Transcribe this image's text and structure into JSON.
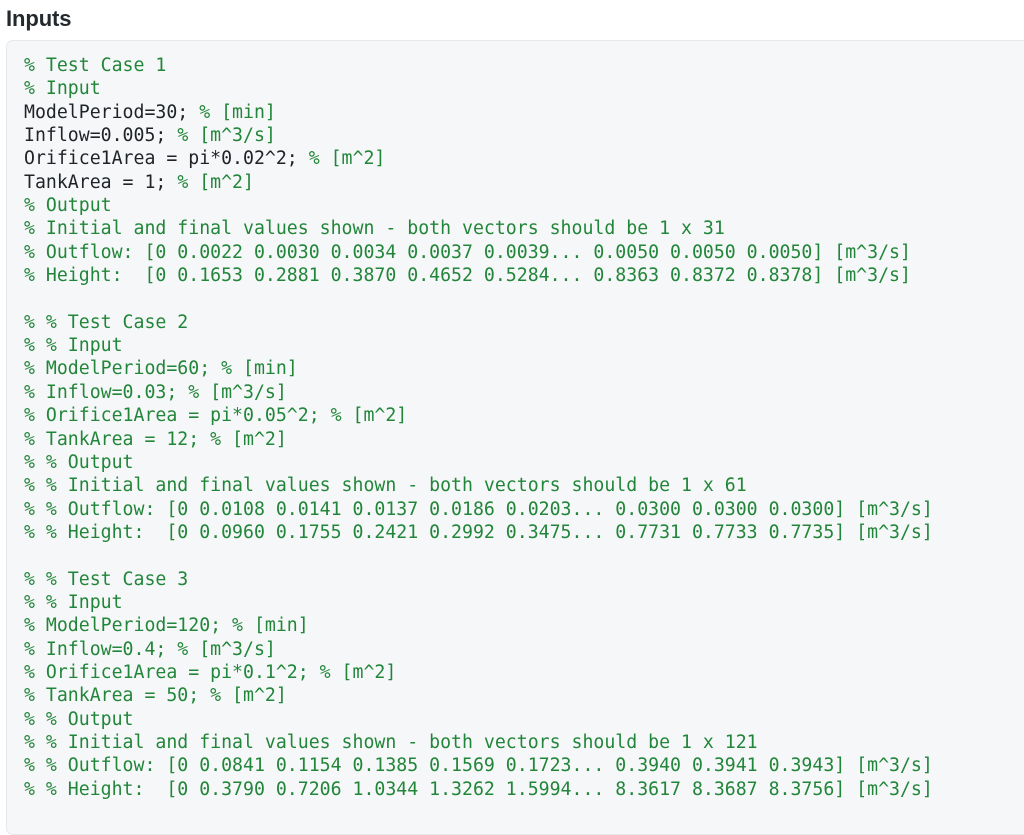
{
  "header": {
    "title": "Inputs"
  },
  "code_block": {
    "language": "matlab",
    "comment_color": "#22863a",
    "code_color": "#1f2328",
    "background_color": "#f6f7f8",
    "border_color": "#e6e8ea",
    "lines": [
      {
        "type": "comment",
        "text": "% Test Case 1"
      },
      {
        "type": "comment",
        "text": "% Input"
      },
      {
        "type": "mixed",
        "code": "ModelPeriod=30; ",
        "comment": "% [min]"
      },
      {
        "type": "mixed",
        "code": "Inflow=0.005; ",
        "comment": "% [m^3/s]"
      },
      {
        "type": "mixed",
        "code": "Orifice1Area = pi*0.02^2; ",
        "comment": "% [m^2]"
      },
      {
        "type": "mixed",
        "code": "TankArea = 1; ",
        "comment": "% [m^2]"
      },
      {
        "type": "comment",
        "text": "% Output"
      },
      {
        "type": "comment",
        "text": "% Initial and final values shown - both vectors should be 1 x 31"
      },
      {
        "type": "comment",
        "text": "% Outflow: [0 0.0022 0.0030 0.0034 0.0037 0.0039... 0.0050 0.0050 0.0050] [m^3/s]"
      },
      {
        "type": "comment",
        "text": "% Height:  [0 0.1653 0.2881 0.3870 0.4652 0.5284... 0.8363 0.8372 0.8378] [m^3/s]"
      },
      {
        "type": "blank",
        "text": ""
      },
      {
        "type": "comment",
        "text": "% % Test Case 2"
      },
      {
        "type": "comment",
        "text": "% % Input"
      },
      {
        "type": "comment",
        "text": "% ModelPeriod=60; % [min]"
      },
      {
        "type": "comment",
        "text": "% Inflow=0.03; % [m^3/s]"
      },
      {
        "type": "comment",
        "text": "% Orifice1Area = pi*0.05^2; % [m^2]"
      },
      {
        "type": "comment",
        "text": "% TankArea = 12; % [m^2]"
      },
      {
        "type": "comment",
        "text": "% % Output"
      },
      {
        "type": "comment",
        "text": "% % Initial and final values shown - both vectors should be 1 x 61"
      },
      {
        "type": "comment",
        "text": "% % Outflow: [0 0.0108 0.0141 0.0137 0.0186 0.0203... 0.0300 0.0300 0.0300] [m^3/s]"
      },
      {
        "type": "comment",
        "text": "% % Height:  [0 0.0960 0.1755 0.2421 0.2992 0.3475... 0.7731 0.7733 0.7735] [m^3/s]"
      },
      {
        "type": "blank",
        "text": ""
      },
      {
        "type": "comment",
        "text": "% % Test Case 3"
      },
      {
        "type": "comment",
        "text": "% % Input"
      },
      {
        "type": "comment",
        "text": "% ModelPeriod=120; % [min]"
      },
      {
        "type": "comment",
        "text": "% Inflow=0.4; % [m^3/s]"
      },
      {
        "type": "comment",
        "text": "% Orifice1Area = pi*0.1^2; % [m^2]"
      },
      {
        "type": "comment",
        "text": "% TankArea = 50; % [m^2]"
      },
      {
        "type": "comment",
        "text": "% % Output"
      },
      {
        "type": "comment",
        "text": "% % Initial and final values shown - both vectors should be 1 x 121"
      },
      {
        "type": "comment",
        "text": "% % Outflow: [0 0.0841 0.1154 0.1385 0.1569 0.1723... 0.3940 0.3941 0.3943] [m^3/s]"
      },
      {
        "type": "comment",
        "text": "% % Height:  [0 0.3790 0.7206 1.0344 1.3262 1.5994... 8.3617 8.3687 8.3756] [m^3/s]"
      }
    ]
  }
}
